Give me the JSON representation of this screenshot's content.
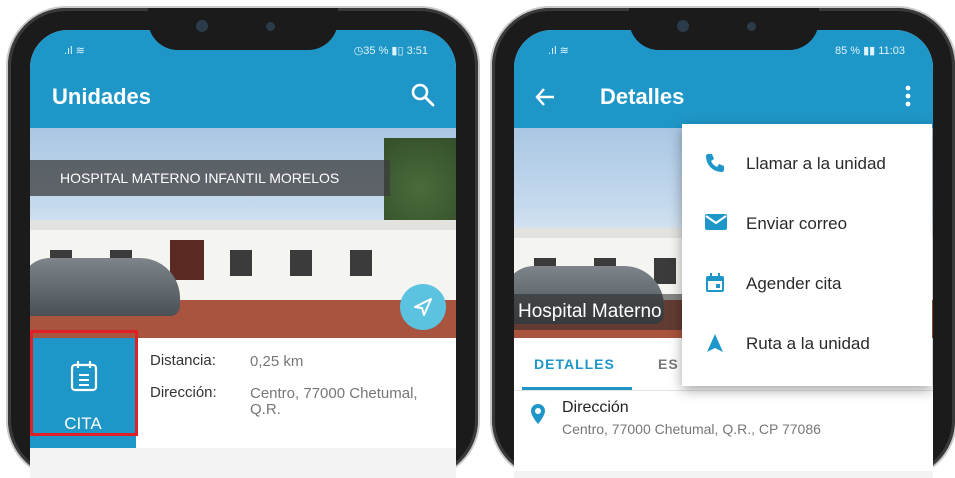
{
  "left_phone": {
    "status": {
      "left": "⁠.ıl ≋",
      "right": "◷35 % ▮▯ 3:51"
    },
    "appbar": {
      "title": "Unidades",
      "search_icon": "search-icon"
    },
    "card": {
      "banner": "HOSPITAL MATERNO INFANTIL MORELOS",
      "cita_label": "CITA",
      "distance_key": "Distancia:",
      "distance_value": "0,25 km",
      "address_key": "Dirección:",
      "address_value_line1": "Centro, 77000 Chetumal,",
      "address_value_line2": "Q.R."
    }
  },
  "right_phone": {
    "status": {
      "left": "⁠.ıl ≋",
      "right": "85 % ▮▮ 11:03"
    },
    "appbar": {
      "title": "Detalles",
      "back_icon": "arrow-left-icon",
      "more_icon": "more-vert-icon"
    },
    "photo_caption": "Hospital Materno",
    "menu": [
      {
        "label": "Llamar a la unidad",
        "icon": "phone-icon"
      },
      {
        "label": "Enviar correo",
        "icon": "mail-icon"
      },
      {
        "label": "Agender cita",
        "icon": "calendar-icon"
      },
      {
        "label": "Ruta a la unidad",
        "icon": "navigation-icon"
      }
    ],
    "tabs": {
      "tab1": "DETALLES",
      "tab2": "ES",
      "tab3_partial": "S"
    },
    "detail": {
      "heading": "Dirección",
      "value": "Centro, 77000 Chetumal, Q.R., CP 77086"
    }
  },
  "colors": {
    "primary": "#1e97c8",
    "highlight": "#e01f26",
    "accent_fab": "#5bc2e0"
  }
}
